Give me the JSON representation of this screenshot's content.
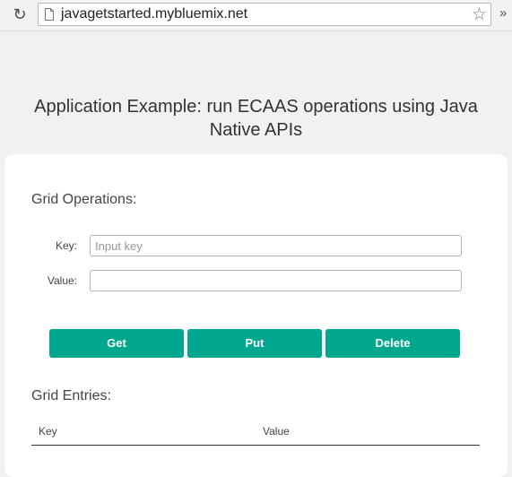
{
  "browser": {
    "url": "javagetstarted.mybluemix.net",
    "overflow_glyph": "»",
    "icons": [
      "reload-icon",
      "page-icon",
      "star-icon",
      "overflow-chevron-icon"
    ]
  },
  "page": {
    "title": "Application Example: run ECAAS operations using Java Native APIs"
  },
  "grid_operations": {
    "title": "Grid Operations:",
    "key_label": "Key:",
    "key_placeholder": "Input key",
    "key_value": "",
    "value_label": "Value:",
    "value_value": ""
  },
  "buttons": {
    "get": "Get",
    "put": "Put",
    "delete": "Delete",
    "accent_color": "#00a78f"
  },
  "grid_entries": {
    "title": "Grid Entries:",
    "columns": [
      "Key",
      "Value"
    ],
    "rows": []
  }
}
